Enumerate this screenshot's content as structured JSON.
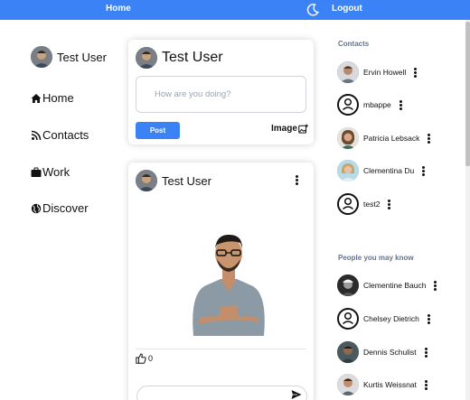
{
  "topbar": {
    "home": "Home",
    "logout": "Logout",
    "theme_icon": "moon-icon",
    "color": "#3b82f6"
  },
  "user": {
    "name": "Test User"
  },
  "nav": [
    {
      "label": "Home",
      "icon": "home-icon"
    },
    {
      "label": "Contacts",
      "icon": "rss-icon"
    },
    {
      "label": "Work",
      "icon": "briefcase-icon"
    },
    {
      "label": "Discover",
      "icon": "globe-icon"
    }
  ],
  "composer": {
    "placeholder": "How are you doing?",
    "post_label": "Post",
    "image_label": "Image"
  },
  "post": {
    "author": "Test User",
    "likes": "0"
  },
  "contacts": {
    "title": "Contacts",
    "items": [
      {
        "name": "Ervin Howell"
      },
      {
        "name": "mbappe"
      },
      {
        "name": "Patricia Lebsack"
      },
      {
        "name": "Clementina Du"
      },
      {
        "name": "test2"
      }
    ]
  },
  "suggestions": {
    "title": "People you may know",
    "items": [
      {
        "name": "Clementine Bauch"
      },
      {
        "name": "Chelsey Dietrich"
      },
      {
        "name": "Dennis Schulist"
      },
      {
        "name": "Kurtis Weissnat"
      }
    ]
  }
}
